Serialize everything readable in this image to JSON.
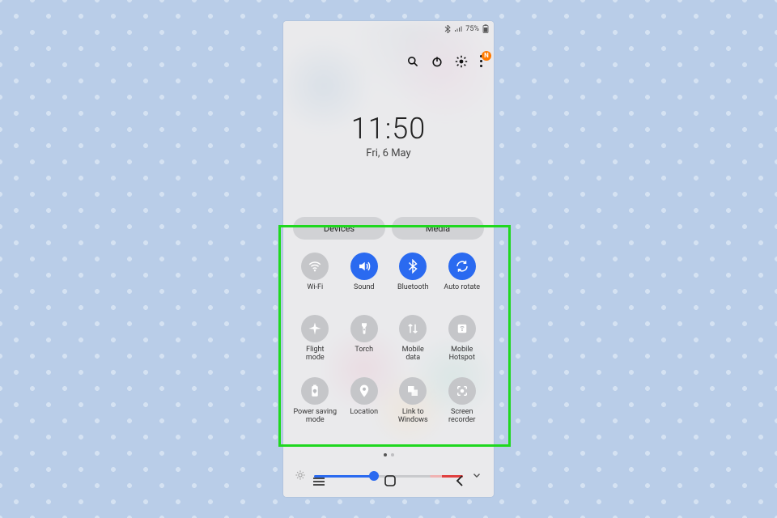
{
  "status": {
    "battery_pct": "75%",
    "badge_letter": "N"
  },
  "clock": {
    "time": "11:50",
    "date": "Fri, 6 May"
  },
  "chips": {
    "devices": "Devices",
    "media": "Media"
  },
  "toggles": [
    {
      "id": "wifi",
      "label": "Wi-Fi",
      "active": false
    },
    {
      "id": "sound",
      "label": "Sound",
      "active": true
    },
    {
      "id": "bluetooth",
      "label": "Bluetooth",
      "active": true
    },
    {
      "id": "autorotate",
      "label": "Auto rotate",
      "active": true
    },
    {
      "id": "flight",
      "label": "Flight\nmode",
      "active": false
    },
    {
      "id": "torch",
      "label": "Torch",
      "active": false
    },
    {
      "id": "mobiledata",
      "label": "Mobile\ndata",
      "active": false
    },
    {
      "id": "hotspot",
      "label": "Mobile\nHotspot",
      "active": false
    },
    {
      "id": "powersave",
      "label": "Power saving\nmode",
      "active": false
    },
    {
      "id": "location",
      "label": "Location",
      "active": false
    },
    {
      "id": "linkwindows",
      "label": "Link to\nWindows",
      "active": false
    },
    {
      "id": "screenrecord",
      "label": "Screen\nrecorder",
      "active": false
    }
  ],
  "brightness": {
    "value_pct": 40
  }
}
